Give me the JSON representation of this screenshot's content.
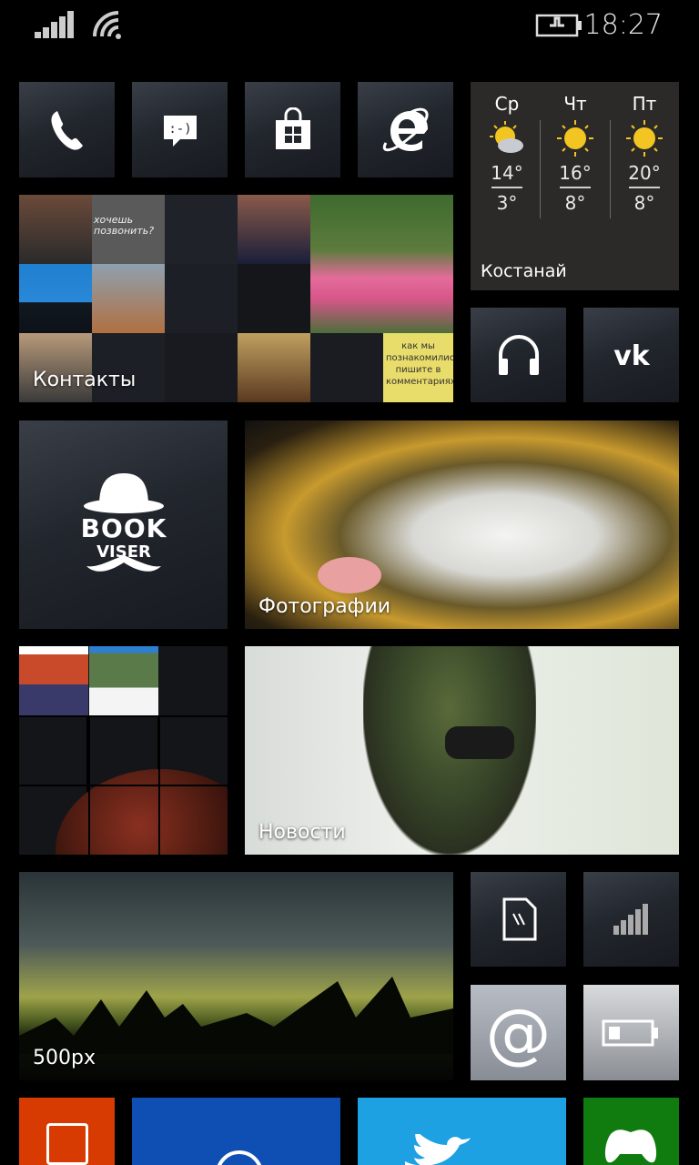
{
  "status": {
    "time": "18:27"
  },
  "tiles": {
    "phone": "phone",
    "messaging": "messaging",
    "store": "store",
    "browser": "internet-explorer",
    "contacts": {
      "label": "Контакты",
      "collage_text_1": "хочешь позвонить?",
      "collage_text_2": "как мы познакомились? пишите в комментариях"
    },
    "music": "music",
    "vk": "vk",
    "bookviser": {
      "line1": "BOOK",
      "line2": "VISER"
    },
    "photos": {
      "label": "Фотографии"
    },
    "news": {
      "label": "Новости"
    },
    "px500": {
      "label": "500px"
    },
    "office": "office",
    "data_sense": "data-sense",
    "mail": "mail",
    "battery": "battery-saver"
  },
  "weather": {
    "city": "Костанай",
    "days": [
      {
        "day": "Ср",
        "high": "14°",
        "low": "3°",
        "icon": "partly-cloudy"
      },
      {
        "day": "Чт",
        "high": "16°",
        "low": "8°",
        "icon": "sunny"
      },
      {
        "day": "Пт",
        "high": "20°",
        "low": "8°",
        "icon": "sunny"
      }
    ]
  },
  "colors": {
    "office": "#d83b01",
    "blue": "#0f4fb3",
    "twitter": "#1da1e2",
    "xbox": "#107c10"
  }
}
